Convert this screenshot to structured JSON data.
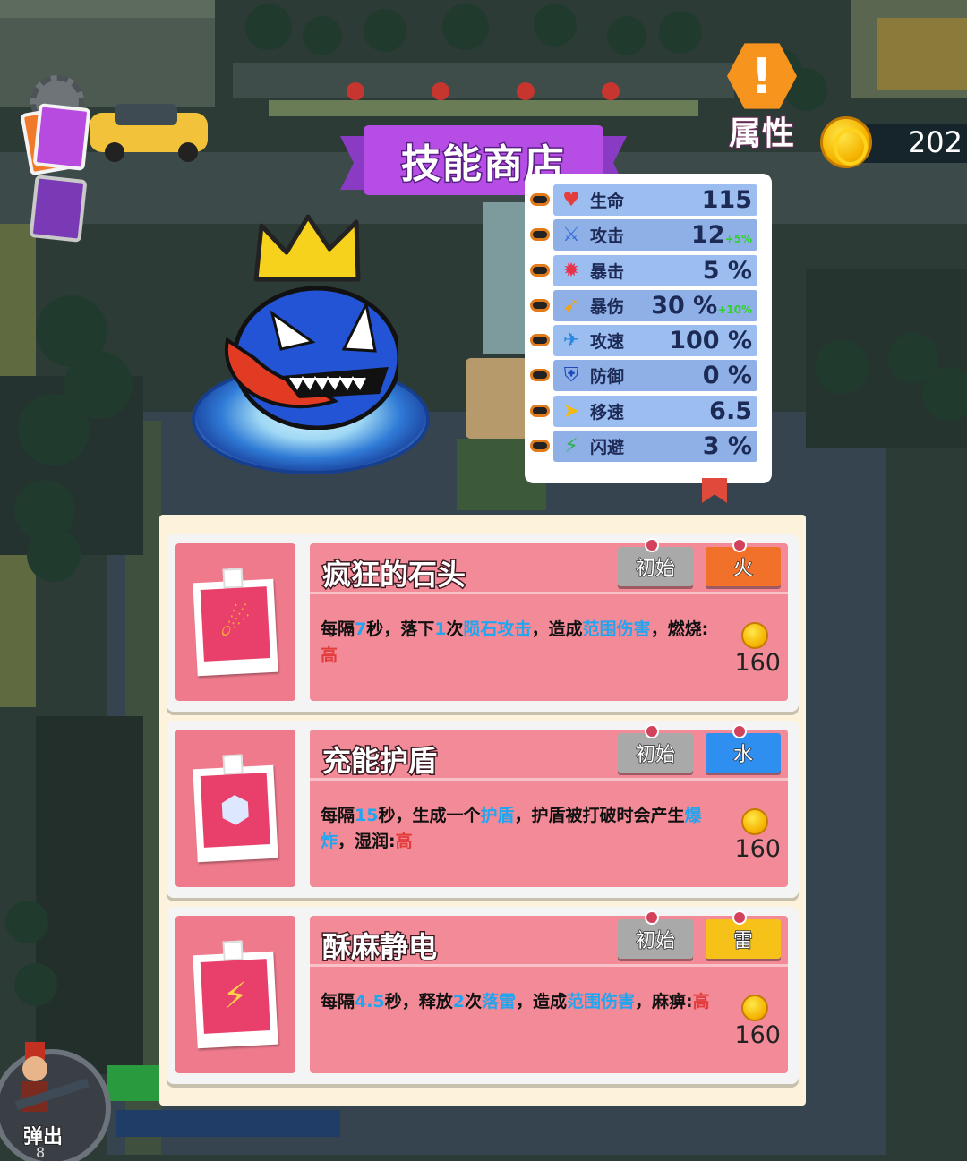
{
  "hud": {
    "attribute_label": "属性",
    "coins": "202",
    "eject_label": "弹出",
    "eject_count": "8"
  },
  "shop": {
    "title": "技能商店"
  },
  "stats": [
    {
      "icon": "heart-icon",
      "glyph": "♥",
      "color": "#e53d3d",
      "name": "生命",
      "value": "115",
      "bonus": ""
    },
    {
      "icon": "sword-icon",
      "glyph": "⚔",
      "color": "#2f6fd8",
      "name": "攻击",
      "value": "12",
      "bonus": "+5%"
    },
    {
      "icon": "crit-icon",
      "glyph": "✹",
      "color": "#e8314a",
      "name": "暴击",
      "value": "5 %",
      "bonus": ""
    },
    {
      "icon": "crit-damage-icon",
      "glyph": "➹",
      "color": "#f0a21a",
      "name": "暴伤",
      "value": "30 %",
      "bonus": "+10%"
    },
    {
      "icon": "attack-speed-icon",
      "glyph": "✈",
      "color": "#2a88e0",
      "name": "攻速",
      "value": "100 %",
      "bonus": ""
    },
    {
      "icon": "shield-icon",
      "glyph": "⛨",
      "color": "#1f49b8",
      "name": "防御",
      "value": "0 %",
      "bonus": ""
    },
    {
      "icon": "boot-icon",
      "glyph": "➤",
      "color": "#f2b713",
      "name": "移速",
      "value": "6.5",
      "bonus": ""
    },
    {
      "icon": "dodge-icon",
      "glyph": "⚡",
      "color": "#28b24a",
      "name": "闪避",
      "value": "3 %",
      "bonus": ""
    }
  ],
  "skills": [
    {
      "name": "疯狂的石头",
      "grade": "初始",
      "element": "火",
      "element_color": "#f2712a",
      "icon": "meteor-icon",
      "glyph": "☄",
      "desc_parts": [
        {
          "t": "每隔",
          "c": ""
        },
        {
          "t": "7",
          "c": "hl"
        },
        {
          "t": "秒，落下",
          "c": ""
        },
        {
          "t": "1",
          "c": "hl"
        },
        {
          "t": "次",
          "c": ""
        },
        {
          "t": "陨石攻击",
          "c": "hl"
        },
        {
          "t": "，造成",
          "c": ""
        },
        {
          "t": "范围伤害",
          "c": "hl"
        },
        {
          "t": "，燃烧:",
          "c": ""
        },
        {
          "t": "高",
          "c": "hot"
        }
      ],
      "price": "160"
    },
    {
      "name": "充能护盾",
      "grade": "初始",
      "element": "水",
      "element_color": "#2e8ff0",
      "icon": "energy-shield-icon",
      "glyph": "⬢",
      "desc_parts": [
        {
          "t": "每隔",
          "c": ""
        },
        {
          "t": "15",
          "c": "hl"
        },
        {
          "t": "秒，生成一个",
          "c": ""
        },
        {
          "t": "护盾",
          "c": "hl"
        },
        {
          "t": "，护盾被打破时会产生",
          "c": ""
        },
        {
          "t": "爆炸",
          "c": "hl"
        },
        {
          "t": "，湿润:",
          "c": ""
        },
        {
          "t": "高",
          "c": "hot"
        }
      ],
      "price": "160"
    },
    {
      "name": "酥麻静电",
      "grade": "初始",
      "element": "雷",
      "element_color": "#f6c21a",
      "icon": "lightning-icon",
      "glyph": "⚡",
      "desc_parts": [
        {
          "t": "每隔",
          "c": ""
        },
        {
          "t": "4.5",
          "c": "hl"
        },
        {
          "t": "秒，释放",
          "c": ""
        },
        {
          "t": "2",
          "c": "hl"
        },
        {
          "t": "次",
          "c": ""
        },
        {
          "t": "落雷",
          "c": "hl"
        },
        {
          "t": "，造成",
          "c": ""
        },
        {
          "t": "范围伤害",
          "c": "hl"
        },
        {
          "t": "，麻痹:",
          "c": ""
        },
        {
          "t": "高",
          "c": "hot"
        }
      ],
      "price": "160"
    }
  ]
}
